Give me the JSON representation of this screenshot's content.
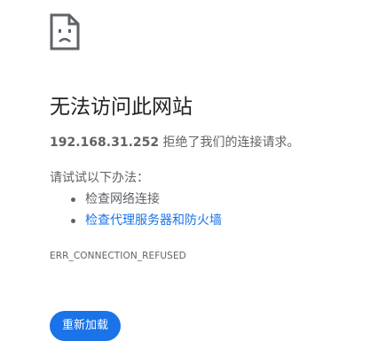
{
  "icon": "sad-page-icon",
  "title": "无法访问此网站",
  "summary": {
    "host": "192.168.31.252",
    "message": " 拒绝了我们的连接请求。"
  },
  "suggestions": {
    "intro": "请试试以下办法：",
    "items": [
      {
        "label": "检查网络连接",
        "is_link": false
      },
      {
        "label": "检查代理服务器和防火墙",
        "is_link": true
      }
    ]
  },
  "error_code": "ERR_CONNECTION_REFUSED",
  "reload_button": {
    "label": "重新加载"
  },
  "colors": {
    "link": "#1a73e8",
    "button_bg": "#1a73e8",
    "text_secondary": "#5f6368",
    "title": "#202124"
  }
}
